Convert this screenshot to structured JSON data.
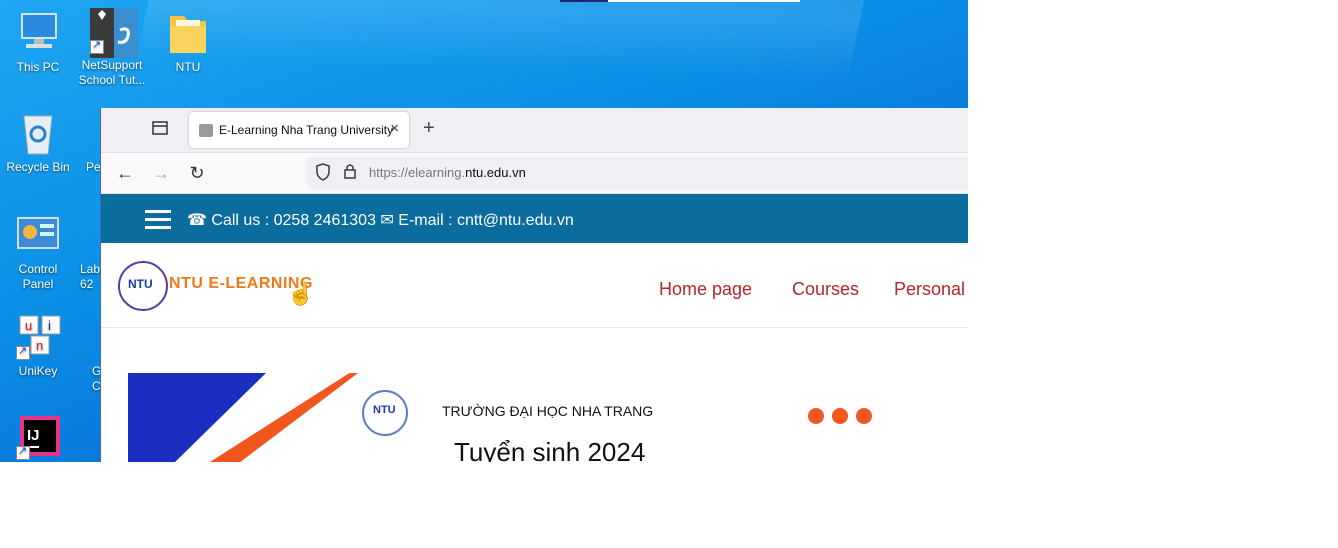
{
  "desktop": {
    "icons": [
      {
        "label": "This PC",
        "icon": "pc-icon"
      },
      {
        "label": "NetSupport School Tut...",
        "icon": "netsupport-icon"
      },
      {
        "label": "NTU",
        "icon": "folder-icon"
      },
      {
        "label": "Recycle Bin",
        "icon": "recycle-bin-icon"
      },
      {
        "label": "Pe",
        "icon": "browser-shortcut-icon"
      },
      {
        "label": "Control Panel",
        "icon": "control-panel-icon"
      },
      {
        "label": "Lab 62",
        "icon": "folder-icon"
      },
      {
        "label": "UniKey",
        "icon": "unikey-icon"
      },
      {
        "label": "G C",
        "icon": "chrome-icon"
      },
      {
        "label": "",
        "icon": "intellij-icon"
      }
    ]
  },
  "browser": {
    "tab_title": "E-Learning Nha Trang University",
    "url_prefix": "https://elearning.",
    "url_domain": "ntu.edu.vn"
  },
  "site": {
    "call": "Call us : 0258 2461303",
    "email": "E-mail : cntt@ntu.edu.vn",
    "logo_text": "NTU E-LEARNING",
    "logo_badge": "NTU",
    "menu": [
      "Home page",
      "Courses",
      "Personal"
    ],
    "banner_university": "TRƯỜNG ĐẠI HỌC NHA TRANG",
    "banner_title": "Tuyển sinh 2024",
    "seal_text": "NTU"
  },
  "colors": {
    "topbar": "#0b6d9e",
    "menu": "#b3262b",
    "accent": "#f0561e"
  }
}
